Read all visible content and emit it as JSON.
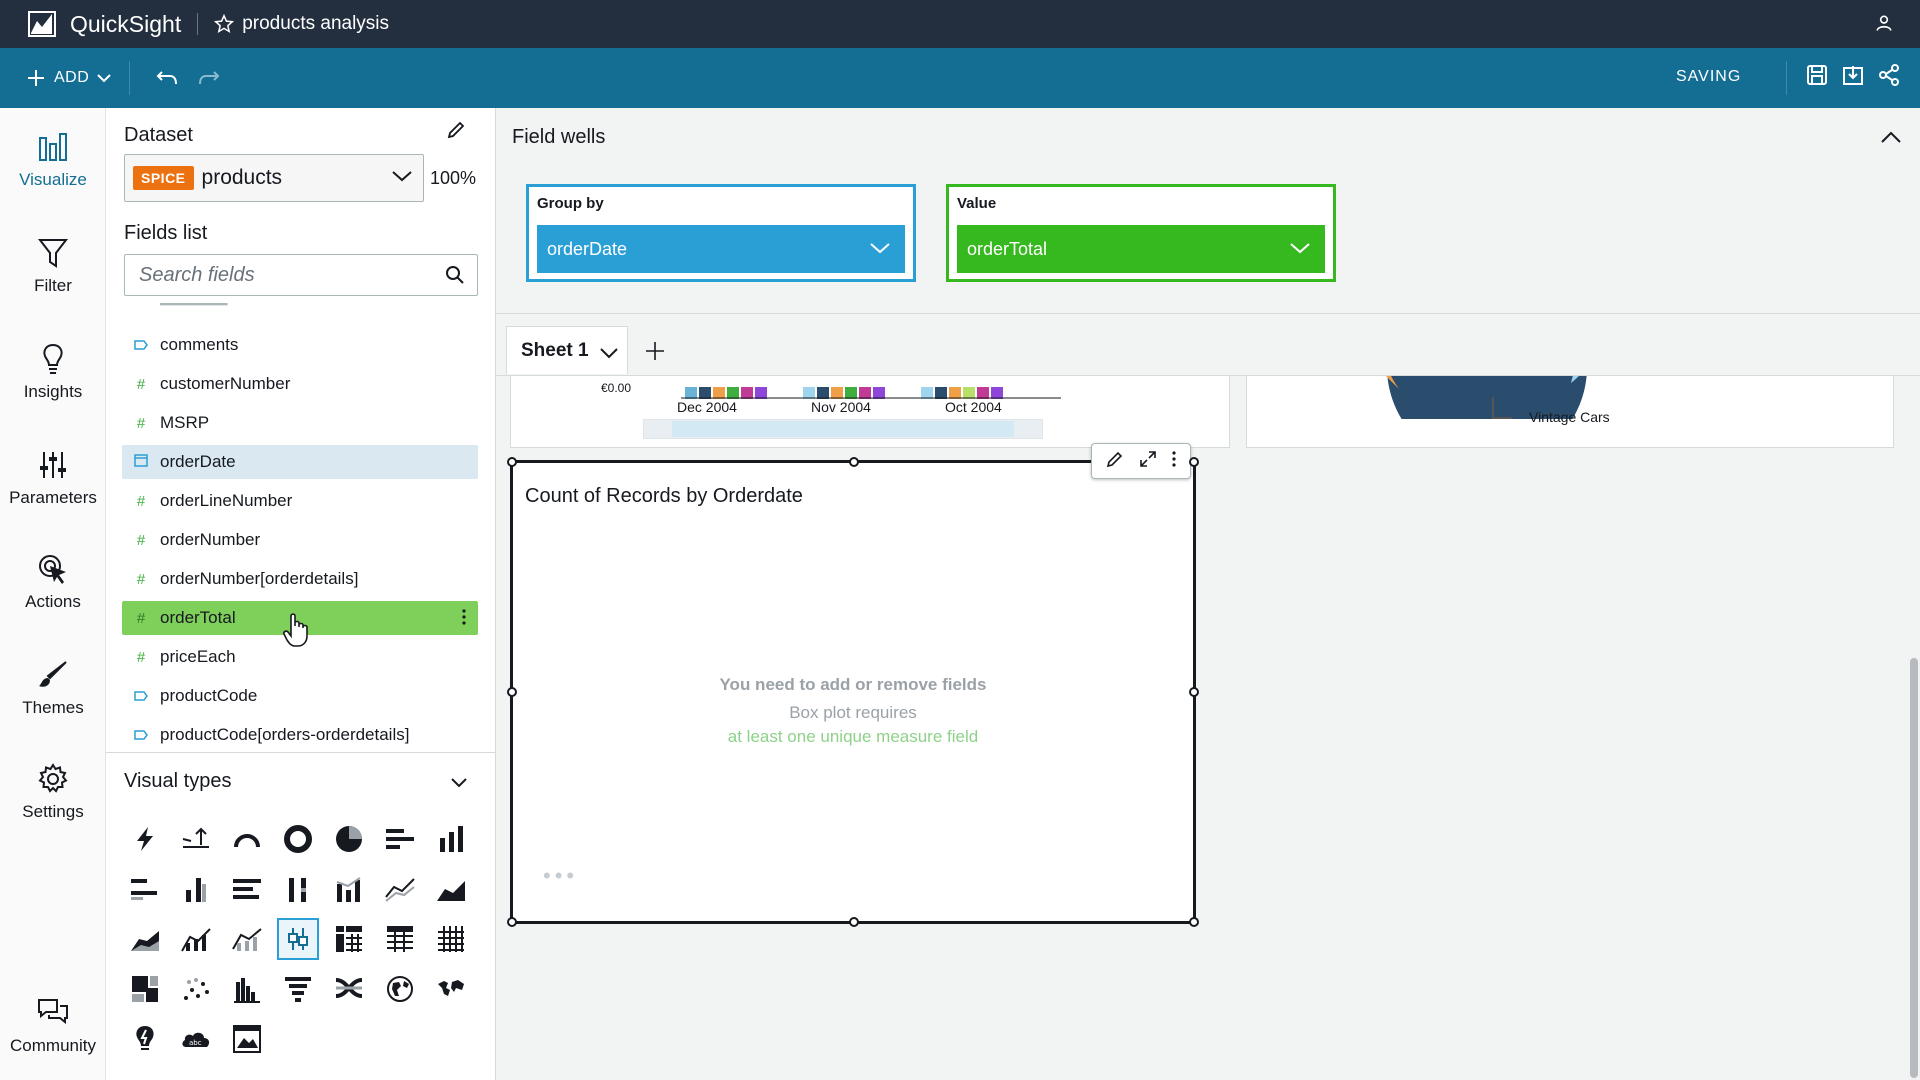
{
  "app": {
    "name": "QuickSight",
    "analysis_title": "products analysis"
  },
  "toolbar": {
    "add_label": "ADD",
    "status": "SAVING"
  },
  "rail": {
    "items": [
      {
        "label": "Visualize",
        "icon": "visualize-icon"
      },
      {
        "label": "Filter",
        "icon": "filter-icon"
      },
      {
        "label": "Insights",
        "icon": "lightbulb-icon"
      },
      {
        "label": "Parameters",
        "icon": "sliders-icon"
      },
      {
        "label": "Actions",
        "icon": "cursor-click-icon"
      },
      {
        "label": "Themes",
        "icon": "brush-icon"
      },
      {
        "label": "Settings",
        "icon": "gear-icon"
      }
    ],
    "community": "Community"
  },
  "dataset": {
    "title": "Dataset",
    "badge": "SPICE",
    "name": "products",
    "percent": "100%"
  },
  "fields": {
    "title": "Fields list",
    "search_placeholder": "Search fields",
    "items": [
      {
        "name": "comments",
        "type": "dimension"
      },
      {
        "name": "customerNumber",
        "type": "measure"
      },
      {
        "name": "MSRP",
        "type": "measure"
      },
      {
        "name": "orderDate",
        "type": "date"
      },
      {
        "name": "orderLineNumber",
        "type": "measure"
      },
      {
        "name": "orderNumber",
        "type": "measure"
      },
      {
        "name": "orderNumber[orderdetails]",
        "type": "measure"
      },
      {
        "name": "orderTotal",
        "type": "measure"
      },
      {
        "name": "priceEach",
        "type": "measure"
      },
      {
        "name": "productCode",
        "type": "dimension"
      },
      {
        "name": "productCode[orders-orderdetails]",
        "type": "dimension"
      }
    ]
  },
  "visual_types": {
    "title": "Visual types"
  },
  "field_wells": {
    "title": "Field wells",
    "group_by": {
      "label": "Group by",
      "field": "orderDate"
    },
    "value": {
      "label": "Value",
      "field": "orderTotal"
    }
  },
  "sheet": {
    "name": "Sheet 1"
  },
  "top_chart": {
    "y_tick": "€0.00",
    "x_ticks": [
      "Dec 2004",
      "Nov 2004",
      "Oct 2004"
    ],
    "legend_label": "Vintage Cars"
  },
  "visual": {
    "title": "Count of Records by Orderdate",
    "message_line1": "You need to add or remove fields",
    "message_line2": "Box plot requires",
    "message_line3": "at least one unique measure field"
  },
  "colors": {
    "topbar": "#232f3e",
    "toolbar": "#146e94",
    "group_well": "#2a9fd6",
    "value_well": "#36b81f",
    "spice": "#ec7211"
  }
}
